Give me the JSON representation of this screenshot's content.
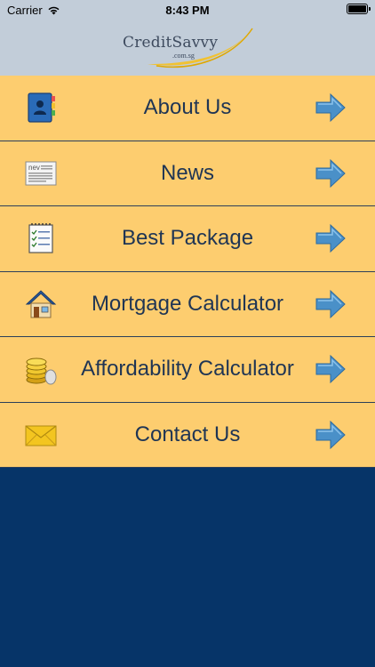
{
  "status_bar": {
    "carrier": "Carrier",
    "time": "8:43 PM"
  },
  "header": {
    "logo_text": "CreditSavvy",
    "logo_sub": ".com.sg"
  },
  "menu": {
    "items": [
      {
        "label": "About Us",
        "icon": "contact-book-icon"
      },
      {
        "label": "News",
        "icon": "newspaper-icon"
      },
      {
        "label": "Best Package",
        "icon": "checklist-notepad-icon"
      },
      {
        "label": "Mortgage Calculator",
        "icon": "house-icon"
      },
      {
        "label": "Affordability Calculator",
        "icon": "coins-icon"
      },
      {
        "label": "Contact Us",
        "icon": "envelope-icon"
      }
    ]
  },
  "colors": {
    "header_bg": "#c2cdd9",
    "menu_bg": "#fdcd6f",
    "menu_text": "#1f3554",
    "bottom_bg": "#063468",
    "arrow": "#4a90c8"
  }
}
